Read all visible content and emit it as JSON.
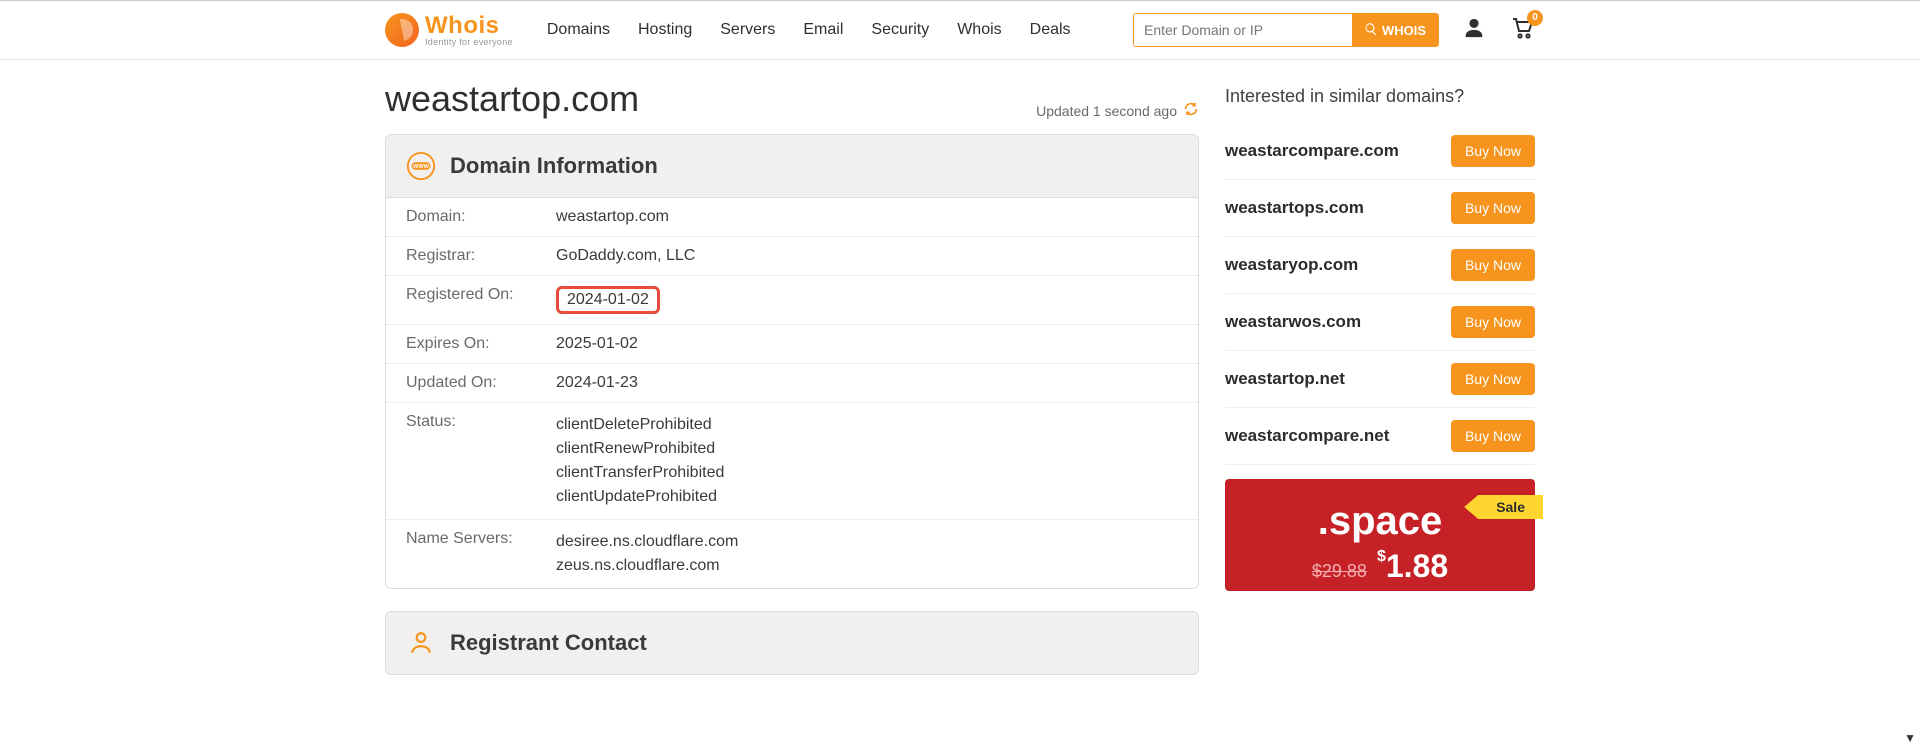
{
  "brand": {
    "name": "Whois",
    "tagline": "Identity for everyone"
  },
  "nav": {
    "items": [
      "Domains",
      "Hosting",
      "Servers",
      "Email",
      "Security",
      "Whois",
      "Deals"
    ]
  },
  "search": {
    "placeholder": "Enter Domain or IP",
    "button_label": "WHOIS"
  },
  "cart": {
    "count": "0"
  },
  "domain": "weastartop.com",
  "updated_text": "Updated 1 second ago",
  "panels": {
    "info_title": "Domain Information",
    "registrant_title": "Registrant Contact"
  },
  "info": {
    "domain_label": "Domain:",
    "domain_value": "weastartop.com",
    "registrar_label": "Registrar:",
    "registrar_value": "GoDaddy.com, LLC",
    "registered_label": "Registered On:",
    "registered_value": "2024-01-02",
    "expires_label": "Expires On:",
    "expires_value": "2025-01-02",
    "updated_label": "Updated On:",
    "updated_value": "2024-01-23",
    "status_label": "Status:",
    "status_values": [
      "clientDeleteProhibited",
      "clientRenewProhibited",
      "clientTransferProhibited",
      "clientUpdateProhibited"
    ],
    "ns_label": "Name Servers:",
    "ns_values": [
      "desiree.ns.cloudflare.com",
      "zeus.ns.cloudflare.com"
    ]
  },
  "similar": {
    "title": "Interested in similar domains?",
    "buy_label": "Buy Now",
    "items": [
      "weastarcompare.com",
      "weastartops.com",
      "weastaryop.com",
      "weastarwos.com",
      "weastartop.net",
      "weastarcompare.net"
    ]
  },
  "promo": {
    "sale_label": "Sale",
    "tld": ".space",
    "old_price": "$29.88",
    "new_price_currency": "$",
    "new_price": "1.88"
  }
}
